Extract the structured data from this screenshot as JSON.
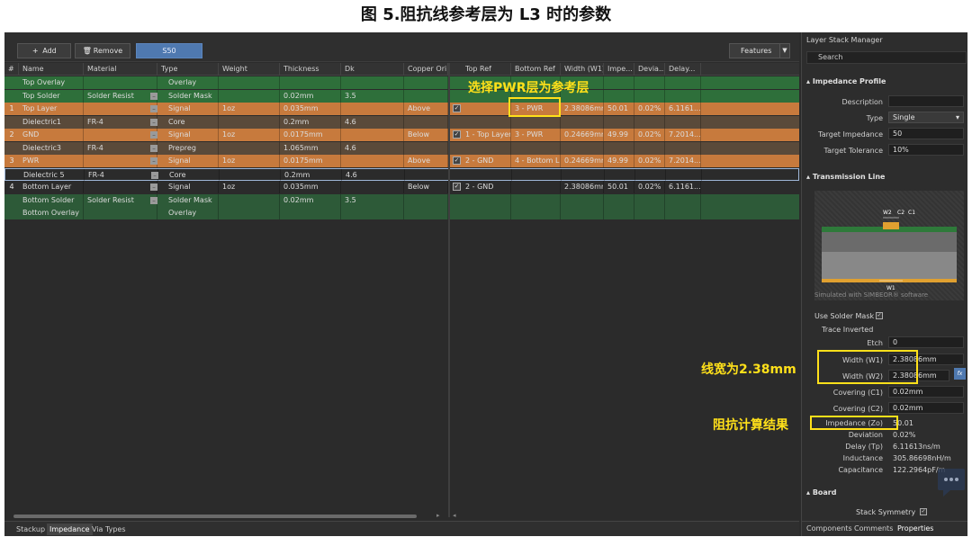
{
  "caption": "图 5.阻抗线参考层为 L3 时的参数",
  "toolbar": {
    "add_label": "Add",
    "remove_label": "Remove",
    "profile_label": "S50",
    "features_label": "Features"
  },
  "columns": [
    "#",
    "Name",
    "Material",
    "Type",
    "Weight",
    "Thickness",
    "Dk",
    "Copper Ori",
    "Top Ref",
    "Bottom Ref",
    "Width (W1)",
    "Impe...",
    "Devia...",
    "Delay..."
  ],
  "rows": [
    {
      "num": "",
      "name": "Top Overlay",
      "material": "",
      "type": "Overlay",
      "weight": "",
      "thickness": "",
      "dk": "",
      "orient": "",
      "top_ref": "",
      "bottom_ref": "",
      "width": "",
      "imp": "",
      "dev": "",
      "delay": "",
      "check": false,
      "color": "green"
    },
    {
      "num": "",
      "name": "Top Solder",
      "material": "Solder Resist",
      "type": "Solder Mask",
      "weight": "",
      "thickness": "0.02mm",
      "dk": "3.5",
      "orient": "",
      "top_ref": "",
      "bottom_ref": "",
      "width": "",
      "imp": "",
      "dev": "",
      "delay": "",
      "check": false,
      "color": "green"
    },
    {
      "num": "1",
      "name": "Top Layer",
      "material": "",
      "type": "Signal",
      "weight": "1oz",
      "thickness": "0.035mm",
      "dk": "",
      "orient": "Above",
      "top_ref": "",
      "bottom_ref": "3 - PWR",
      "width": "2.38086mm",
      "imp": "50.01",
      "dev": "0.02%",
      "delay": "6.1161...",
      "check": true,
      "color": "orange"
    },
    {
      "num": "",
      "name": "Dielectric1",
      "material": "FR-4",
      "type": "Core",
      "weight": "",
      "thickness": "0.2mm",
      "dk": "4.6",
      "orient": "",
      "top_ref": "",
      "bottom_ref": "",
      "width": "",
      "imp": "",
      "dev": "",
      "delay": "",
      "check": false,
      "color": "brown"
    },
    {
      "num": "2",
      "name": "GND",
      "material": "",
      "type": "Signal",
      "weight": "1oz",
      "thickness": "0.0175mm",
      "dk": "",
      "orient": "Below",
      "top_ref": "1 - Top Layer",
      "bottom_ref": "3 - PWR",
      "width": "0.24669mm",
      "imp": "49.99",
      "dev": "0.02%",
      "delay": "7.2014...",
      "check": true,
      "color": "orange"
    },
    {
      "num": "",
      "name": "Dielectric3",
      "material": "FR-4",
      "type": "Prepreg",
      "weight": "",
      "thickness": "1.065mm",
      "dk": "4.6",
      "orient": "",
      "top_ref": "",
      "bottom_ref": "",
      "width": "",
      "imp": "",
      "dev": "",
      "delay": "",
      "check": false,
      "color": "brown"
    },
    {
      "num": "3",
      "name": "PWR",
      "material": "",
      "type": "Signal",
      "weight": "1oz",
      "thickness": "0.0175mm",
      "dk": "",
      "orient": "Above",
      "top_ref": "2 - GND",
      "bottom_ref": "4 - Bottom L...",
      "width": "0.24669mm",
      "imp": "49.99",
      "dev": "0.02%",
      "delay": "7.2014...",
      "check": true,
      "color": "orange"
    },
    {
      "num": "",
      "name": "Dielectric 5",
      "material": "FR-4",
      "type": "Core",
      "weight": "",
      "thickness": "0.2mm",
      "dk": "4.6",
      "orient": "",
      "top_ref": "",
      "bottom_ref": "",
      "width": "",
      "imp": "",
      "dev": "",
      "delay": "",
      "check": false,
      "color": "selected"
    },
    {
      "num": "4",
      "name": "Bottom Layer",
      "material": "",
      "type": "Signal",
      "weight": "1oz",
      "thickness": "0.035mm",
      "dk": "",
      "orient": "Below",
      "top_ref": "2 - GND",
      "bottom_ref": "",
      "width": "2.38086mm",
      "imp": "50.01",
      "dev": "0.02%",
      "delay": "6.1161...",
      "check": true,
      "color": "dark"
    },
    {
      "num": "",
      "name": "Bottom Solder",
      "material": "Solder Resist",
      "type": "Solder Mask",
      "weight": "",
      "thickness": "0.02mm",
      "dk": "3.5",
      "orient": "",
      "top_ref": "",
      "bottom_ref": "",
      "width": "",
      "imp": "",
      "dev": "",
      "delay": "",
      "check": false,
      "color": "green2"
    },
    {
      "num": "",
      "name": "Bottom Overlay",
      "material": "",
      "type": "Overlay",
      "weight": "",
      "thickness": "",
      "dk": "",
      "orient": "",
      "top_ref": "",
      "bottom_ref": "",
      "width": "",
      "imp": "",
      "dev": "",
      "delay": "",
      "check": false,
      "color": "green2"
    }
  ],
  "tabs": [
    "Stackup",
    "Impedance",
    "Via Types"
  ],
  "panel": {
    "title": "Layer Stack Manager",
    "search_placeholder": "Search",
    "impedance_profile": "Impedance Profile",
    "description_label": "Description",
    "description_value": "",
    "type_label": "Type",
    "type_value": "Single",
    "target_impedance_label": "Target Impedance",
    "target_impedance_value": "50",
    "target_tolerance_label": "Target Tolerance",
    "target_tolerance_value": "10%",
    "transmission_line": "Transmission Line",
    "diagram_w2": "W2",
    "diagram_c2": "C2",
    "diagram_c1": "C1",
    "diagram_w1": "W1",
    "simulated_note": "Simulated with SIMBEOR® software",
    "use_solder_mask_label": "Use Solder Mask",
    "trace_inverted_label": "Trace Inverted",
    "etch_label": "Etch",
    "etch_value": "0",
    "width_w1_label": "Width (W1)",
    "width_w1_value": "2.38086mm",
    "width_w2_label": "Width (W2)",
    "width_w2_value": "2.38086mm",
    "covering_c1_label": "Covering (C1)",
    "covering_c1_value": "0.02mm",
    "covering_c2_label": "Covering (C2)",
    "covering_c2_value": "0.02mm",
    "impedance_label": "Impedance (Zo)",
    "impedance_value": "50.01",
    "deviation_label": "Deviation",
    "deviation_value": "0.02%",
    "delay_label": "Delay (Tp)",
    "delay_value": "6.11613ns/m",
    "inductance_label": "Inductance",
    "inductance_value": "305.86698nH/m",
    "capacitance_label": "Capacitance",
    "capacitance_value": "122.2964pF/m",
    "board": "Board",
    "stack_symmetry_label": "Stack Symmetry",
    "bottom_tabs": [
      "Components",
      "Comments",
      "Properties"
    ]
  },
  "annotations": {
    "ref_layer": "选择PWR层为参考层",
    "line_width": "线宽为2.38mm",
    "impedance_result": "阻抗计算结果"
  },
  "colors": {
    "green": "#2e6f3a",
    "orange": "#c77a3d",
    "brown": "#5a4a3a",
    "annotation": "#ffe01a"
  }
}
